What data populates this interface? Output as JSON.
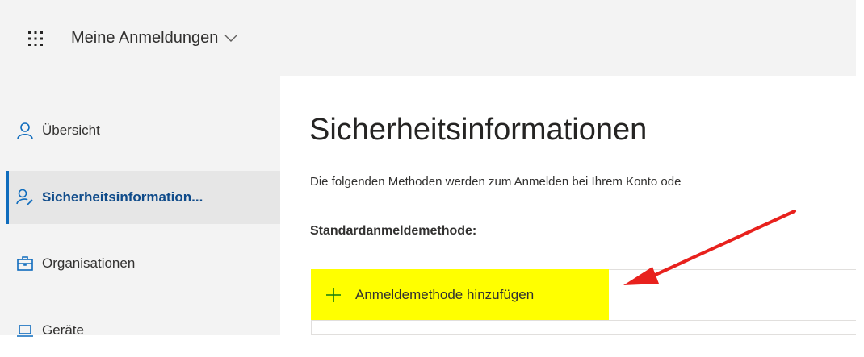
{
  "header": {
    "app_title": "Meine Anmeldungen",
    "waffle_icon": "waffle-icon",
    "chevron_icon": "chevron-down-icon"
  },
  "sidebar": {
    "items": [
      {
        "label": "Übersicht",
        "icon": "person-icon",
        "active": false
      },
      {
        "label": "Sicherheitsinformation...",
        "icon": "person-key-icon",
        "active": true
      },
      {
        "label": "Organisationen",
        "icon": "briefcase-icon",
        "active": false
      },
      {
        "label": "Geräte",
        "icon": "laptop-icon",
        "active": false
      }
    ]
  },
  "main": {
    "title": "Sicherheitsinformationen",
    "description": "Die folgenden Methoden werden zum Anmelden bei Ihrem Konto ode",
    "default_method_label": "Standardanmeldemethode:",
    "add_method_label": "Anmeldemethode hinzufügen",
    "highlight_color": "#ffff00",
    "annotation_arrow_color": "#e8211d"
  },
  "colors": {
    "accent": "#0f6cbd",
    "background_gray": "#f3f3f3",
    "active_bg": "#e6e6e6"
  }
}
